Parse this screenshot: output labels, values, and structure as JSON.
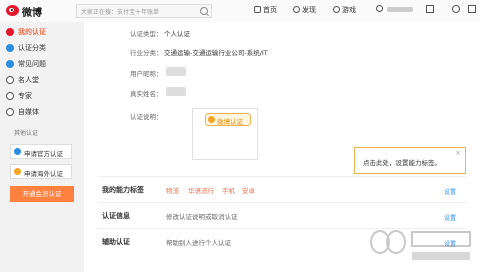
{
  "header": {
    "logo_text": "微博",
    "search_placeholder": "大家正在搜：支付宝十年账单",
    "nav": [
      {
        "label": "首页",
        "icon": "home-icon"
      },
      {
        "label": "发现",
        "icon": "compass-icon"
      },
      {
        "label": "游戏",
        "icon": "gamepad-icon"
      }
    ]
  },
  "sidebar": {
    "items": [
      {
        "label": "我的认证",
        "icon": "weibo-icon",
        "color": "#e6162d"
      },
      {
        "label": "认证分类",
        "icon": "v-badge-icon",
        "color": "#2a8ee0"
      },
      {
        "label": "常见问题",
        "icon": "question-icon",
        "color": "#2a8ee0"
      },
      {
        "label": "名人堂",
        "icon": "person-icon",
        "color": "#555555"
      },
      {
        "label": "专家",
        "icon": "expert-icon",
        "color": "#555555"
      },
      {
        "label": "自媒体",
        "icon": "media-icon",
        "color": "#555555"
      }
    ],
    "heading": "其他认证",
    "buttons": [
      "申请官方认证",
      "申请海外认证"
    ],
    "cta": "开通会员认证"
  },
  "profile": {
    "type_label": "认证类型：",
    "type_value": "个人认证",
    "industry_label": "行业分类：",
    "industry_value": "交通运输-交通运输行业公司-系统/IT",
    "nickname_label": "用户昵称：",
    "realname_label": "真实姓名：",
    "desc_label": "认证说明：",
    "badge_text": "微博认证"
  },
  "sections": {
    "tags_title": "我的能力标签",
    "tags": [
      "物流",
      "华语流行",
      "手机",
      "安卓"
    ],
    "info_title": "认证信息",
    "info_desc": "修改认证说明或取消认证",
    "assist_title": "辅助认证",
    "assist_desc": "帮助别人进行个人认证",
    "set_label": "设置"
  },
  "tooltip": {
    "text": "点击此处，设置能力标签。",
    "close": "×"
  },
  "colors": {
    "accent": "#ff8140",
    "brand": "#e6162d",
    "link": "#2a8ee0"
  }
}
